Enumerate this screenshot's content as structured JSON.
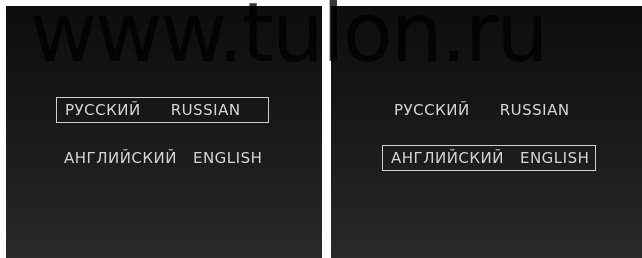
{
  "watermark": "www.tulon.ru",
  "screens": [
    {
      "selected": "russian",
      "options": [
        {
          "native": "РУССКИЙ",
          "english": "RUSSIAN"
        },
        {
          "native": "АНГЛИЙСКИЙ",
          "english": "ENGLISH"
        }
      ]
    },
    {
      "selected": "english",
      "options": [
        {
          "native": "РУССКИЙ",
          "english": "RUSSIAN"
        },
        {
          "native": "АНГЛИЙСКИЙ",
          "english": "ENGLISH"
        }
      ]
    }
  ]
}
